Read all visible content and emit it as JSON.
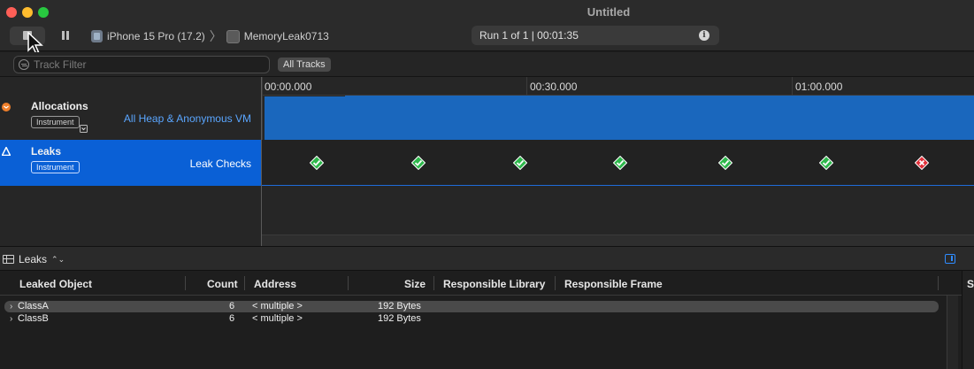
{
  "window": {
    "title": "Untitled"
  },
  "toolbar": {
    "device": "iPhone 15 Pro (17.2)",
    "separator": "〉",
    "target": "MemoryLeak0713",
    "run_status": "Run 1 of 1  |  00:01:35"
  },
  "filter": {
    "placeholder": "Track Filter",
    "all_tracks": "All Tracks"
  },
  "timeline": {
    "ticks": [
      "00:00.000",
      "00:30.000",
      "01:00.000"
    ]
  },
  "tracks": [
    {
      "name": "Allocations",
      "badge": "Instrument",
      "subtitle": "All Heap & Anonymous VM",
      "color": "#1a67bd"
    },
    {
      "name": "Leaks",
      "badge": "Instrument",
      "subtitle": "Leak Checks",
      "color": "#0a60d6"
    }
  ],
  "leak_checks": [
    "ok",
    "ok",
    "ok",
    "ok",
    "ok",
    "ok",
    "leak"
  ],
  "detail": {
    "view": "Leaks",
    "columns": [
      "Leaked Object",
      "Count",
      "Address",
      "Size",
      "Responsible Library",
      "Responsible Frame"
    ],
    "rows": [
      {
        "object": "ClassA",
        "count": "6",
        "address": "< multiple >",
        "size": "192 Bytes",
        "library": "",
        "frame": ""
      },
      {
        "object": "ClassB",
        "count": "6",
        "address": "< multiple >",
        "size": "192 Bytes",
        "library": "",
        "frame": ""
      }
    ],
    "right_pane_label": "S"
  },
  "colors": {
    "accent": "#0a60d6",
    "ok": "#2db84b",
    "leak": "#e0303a"
  }
}
